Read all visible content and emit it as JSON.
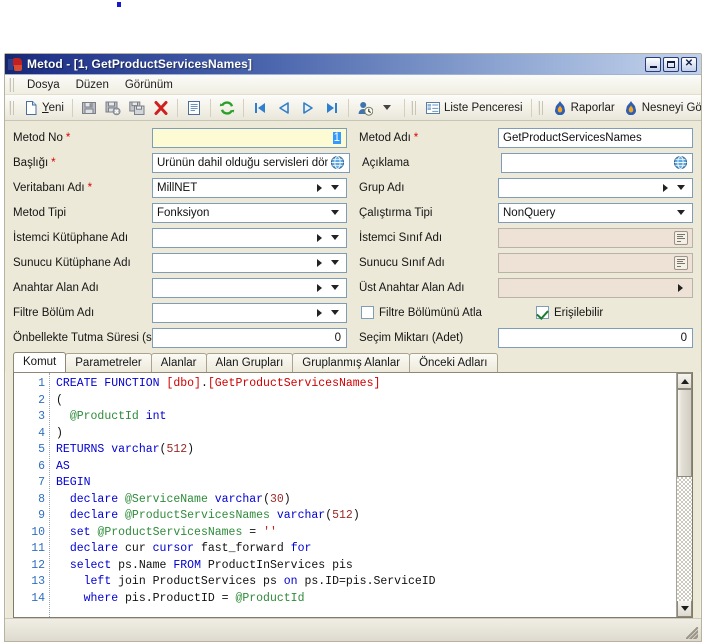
{
  "window": {
    "title": "Metod - [1, GetProductServicesNames]",
    "icon": "app-icon",
    "buttons": {
      "minimize": "_",
      "maximize": "□",
      "close": "✕"
    }
  },
  "menu": {
    "items": [
      "Dosya",
      "Düzen",
      "Görünüm"
    ]
  },
  "toolbar": {
    "new_label": "Yeni",
    "new_label_pre": "Y",
    "new_label_post": "eni",
    "icons": [
      "new-document-icon",
      "save-icon",
      "save-delete-icon",
      "save-copy-icon",
      "delete-icon",
      "copy-icon",
      "refresh-icon",
      "first-record-icon",
      "previous-record-icon",
      "next-record-icon",
      "last-record-icon",
      "history-user-icon",
      "dropdown-icon"
    ],
    "list_window_label": "Liste Penceresi",
    "reports_label": "Raporlar",
    "show_object_label": "Nesneyi Göster / Te"
  },
  "form": {
    "left": [
      {
        "label": "Metod No",
        "required": true,
        "value": "1",
        "type": "text-selected",
        "highlight": "yellow"
      },
      {
        "label": "Başlığı",
        "required": true,
        "value": "Ürünün dahil olduğu servisleri döndür",
        "type": "text-globe"
      },
      {
        "label": "Veritabanı Adı",
        "required": true,
        "value": "MillNET",
        "type": "lookup"
      },
      {
        "label": "Metod Tipi",
        "required": false,
        "value": "Fonksiyon",
        "type": "combo"
      },
      {
        "label": "İstemci Kütüphane Adı",
        "required": false,
        "value": "",
        "type": "lookup"
      },
      {
        "label": "Sunucu Kütüphane Adı",
        "required": false,
        "value": "",
        "type": "lookup"
      },
      {
        "label": "Anahtar Alan Adı",
        "required": false,
        "value": "",
        "type": "lookup"
      },
      {
        "label": "Filtre Bölüm Adı",
        "required": false,
        "value": "",
        "type": "lookup"
      },
      {
        "label": "Önbellekte Tutma Süresi (sn)",
        "required": false,
        "value": "0",
        "type": "number"
      }
    ],
    "right": [
      {
        "label": "Metod Adı",
        "required": true,
        "value": "GetProductServicesNames",
        "type": "text"
      },
      {
        "label": "Açıklama",
        "required": false,
        "value": "",
        "type": "text-globe"
      },
      {
        "label": "Grup Adı",
        "required": false,
        "value": "",
        "type": "lookup"
      },
      {
        "label": "Çalıştırma Tipi",
        "required": false,
        "value": "NonQuery",
        "type": "combo"
      },
      {
        "label": "İstemci Sınıf Adı",
        "required": false,
        "value": "",
        "type": "memo-disabled"
      },
      {
        "label": "Sunucu Sınıf Adı",
        "required": false,
        "value": "",
        "type": "memo-disabled"
      },
      {
        "label": "Üst Anahtar Alan Adı",
        "required": false,
        "value": "",
        "type": "lookup-disabled"
      },
      {
        "label": "Seçim Miktarı (Adet)",
        "required": false,
        "value": "0",
        "type": "number"
      }
    ],
    "checkboxes": [
      {
        "label": "Filtre Bölümünü Atla",
        "checked": false
      },
      {
        "label": "Erişilebilir",
        "checked": true
      }
    ]
  },
  "tabs": {
    "items": [
      "Komut",
      "Parametreler",
      "Alanlar",
      "Alan Grupları",
      "Gruplanmış Alanlar",
      "Önceki Adları"
    ],
    "active_index": 0
  },
  "editor": {
    "line_numbers": [
      "1",
      "2",
      "3",
      "4",
      "5",
      "6",
      "7",
      "8",
      "9",
      "10",
      "11",
      "12",
      "13",
      "14"
    ],
    "lines": [
      [
        {
          "t": "CREATE FUNCTION ",
          "c": "k"
        },
        {
          "t": "[dbo]",
          "c": "r"
        },
        {
          "t": ".",
          "c": "t"
        },
        {
          "t": "[GetProductServicesNames]",
          "c": "r"
        }
      ],
      [
        {
          "t": "(",
          "c": "t"
        }
      ],
      [
        {
          "t": "  ",
          "c": "t"
        },
        {
          "t": "@ProductId",
          "c": "g"
        },
        {
          "t": " ",
          "c": "t"
        },
        {
          "t": "int",
          "c": "k"
        }
      ],
      [
        {
          "t": ")",
          "c": "t"
        }
      ],
      [
        {
          "t": "RETURNS ",
          "c": "k"
        },
        {
          "t": "varchar",
          "c": "k"
        },
        {
          "t": "(",
          "c": "t"
        },
        {
          "t": "512",
          "c": "m"
        },
        {
          "t": ")",
          "c": "t"
        }
      ],
      [
        {
          "t": "AS",
          "c": "k"
        }
      ],
      [
        {
          "t": "BEGIN",
          "c": "k"
        }
      ],
      [
        {
          "t": "  ",
          "c": "t"
        },
        {
          "t": "declare",
          "c": "k"
        },
        {
          "t": " ",
          "c": "t"
        },
        {
          "t": "@ServiceName",
          "c": "g"
        },
        {
          "t": " ",
          "c": "t"
        },
        {
          "t": "varchar",
          "c": "k"
        },
        {
          "t": "(",
          "c": "t"
        },
        {
          "t": "30",
          "c": "m"
        },
        {
          "t": ")",
          "c": "t"
        }
      ],
      [
        {
          "t": "  ",
          "c": "t"
        },
        {
          "t": "declare",
          "c": "k"
        },
        {
          "t": " ",
          "c": "t"
        },
        {
          "t": "@ProductServicesNames",
          "c": "g"
        },
        {
          "t": " ",
          "c": "t"
        },
        {
          "t": "varchar",
          "c": "k"
        },
        {
          "t": "(",
          "c": "t"
        },
        {
          "t": "512",
          "c": "m"
        },
        {
          "t": ")",
          "c": "t"
        }
      ],
      [
        {
          "t": "  ",
          "c": "t"
        },
        {
          "t": "set",
          "c": "k"
        },
        {
          "t": " ",
          "c": "t"
        },
        {
          "t": "@ProductServicesNames",
          "c": "g"
        },
        {
          "t": " = ",
          "c": "t"
        },
        {
          "t": "''",
          "c": "s"
        }
      ],
      [
        {
          "t": "  ",
          "c": "t"
        },
        {
          "t": "declare",
          "c": "k"
        },
        {
          "t": " cur ",
          "c": "t"
        },
        {
          "t": "cursor",
          "c": "k"
        },
        {
          "t": " fast_forward ",
          "c": "t"
        },
        {
          "t": "for",
          "c": "k"
        }
      ],
      [
        {
          "t": "  ",
          "c": "t"
        },
        {
          "t": "select",
          "c": "k"
        },
        {
          "t": " ps.Name ",
          "c": "t"
        },
        {
          "t": "FROM",
          "c": "k"
        },
        {
          "t": " ProductInServices pis",
          "c": "t"
        }
      ],
      [
        {
          "t": "    ",
          "c": "t"
        },
        {
          "t": "left",
          "c": "k"
        },
        {
          "t": " join ProductServices ps ",
          "c": "t"
        },
        {
          "t": "on",
          "c": "k"
        },
        {
          "t": " ps.ID=pis.ServiceID",
          "c": "t"
        }
      ],
      [
        {
          "t": "    ",
          "c": "t"
        },
        {
          "t": "where",
          "c": "k"
        },
        {
          "t": " pis.ProductID = ",
          "c": "t"
        },
        {
          "t": "@ProductId",
          "c": "g"
        }
      ]
    ]
  },
  "colors": {
    "title_start": "#15266e",
    "title_end": "#c2d1ea",
    "form_bg": "#ece9d8",
    "required_star": "#e00000",
    "highlight_field": "#fcfbd4",
    "selection": "#3399ff",
    "keyword": "#0000d0",
    "identifier": "#d00000",
    "variable": "#2e8b3a",
    "number": "#9a2a2a",
    "string": "#c02020",
    "linenumber": "#2f6fbf",
    "checkbox_check": "#1a7a2e"
  }
}
